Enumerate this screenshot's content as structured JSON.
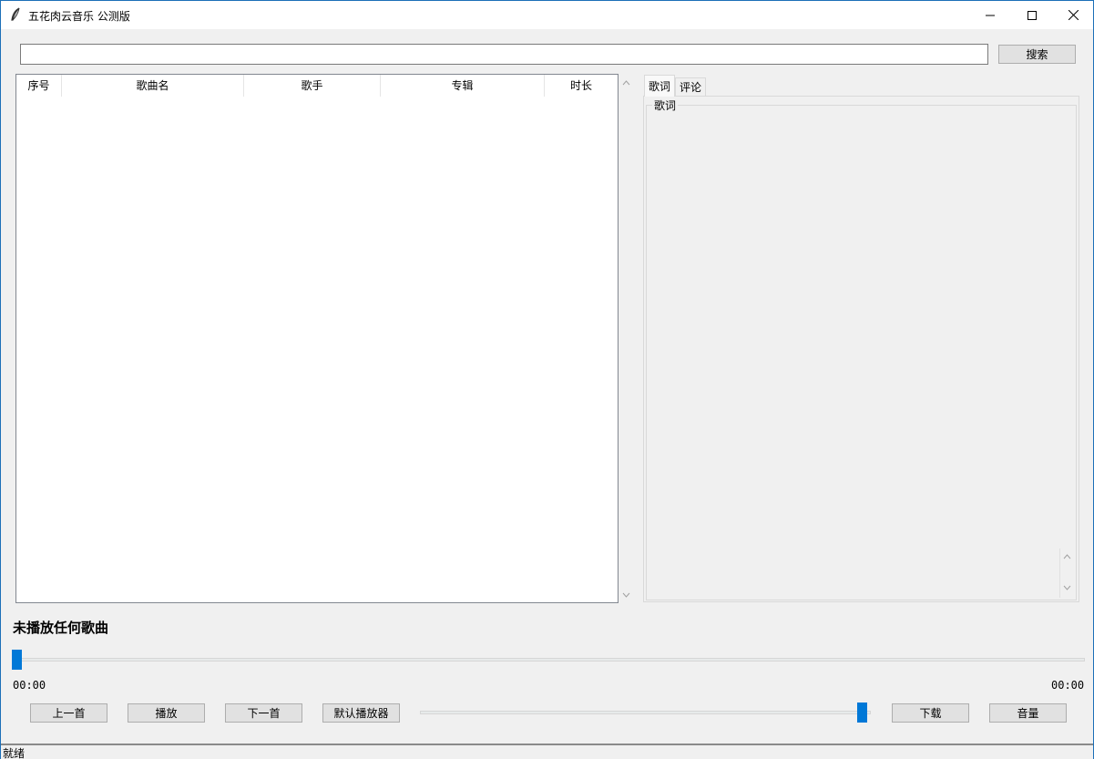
{
  "window": {
    "title": "五花肉云音乐 公测版"
  },
  "search": {
    "value": "",
    "placeholder": "",
    "button_label": "搜索"
  },
  "song_table": {
    "columns": [
      "序号",
      "歌曲名",
      "歌手",
      "专辑",
      "时长"
    ],
    "rows": []
  },
  "notebook": {
    "tabs": [
      "歌词",
      "评论"
    ],
    "active_tab": "歌词",
    "lyrics_group_label": "歌词"
  },
  "player": {
    "now_playing": "未播放任何歌曲",
    "progress": 0,
    "current_time": "00:00",
    "total_time": "00:00",
    "volume_level": 0.97,
    "buttons": {
      "prev": "上一首",
      "play": "播放",
      "next": "下一首",
      "default_player": "默认播放器",
      "download": "下载",
      "volume": "音量"
    }
  },
  "status": {
    "text": "就绪"
  },
  "colors": {
    "accent": "#0078d7",
    "window_border": "#1c6fb8",
    "background": "#f0f0f0"
  }
}
